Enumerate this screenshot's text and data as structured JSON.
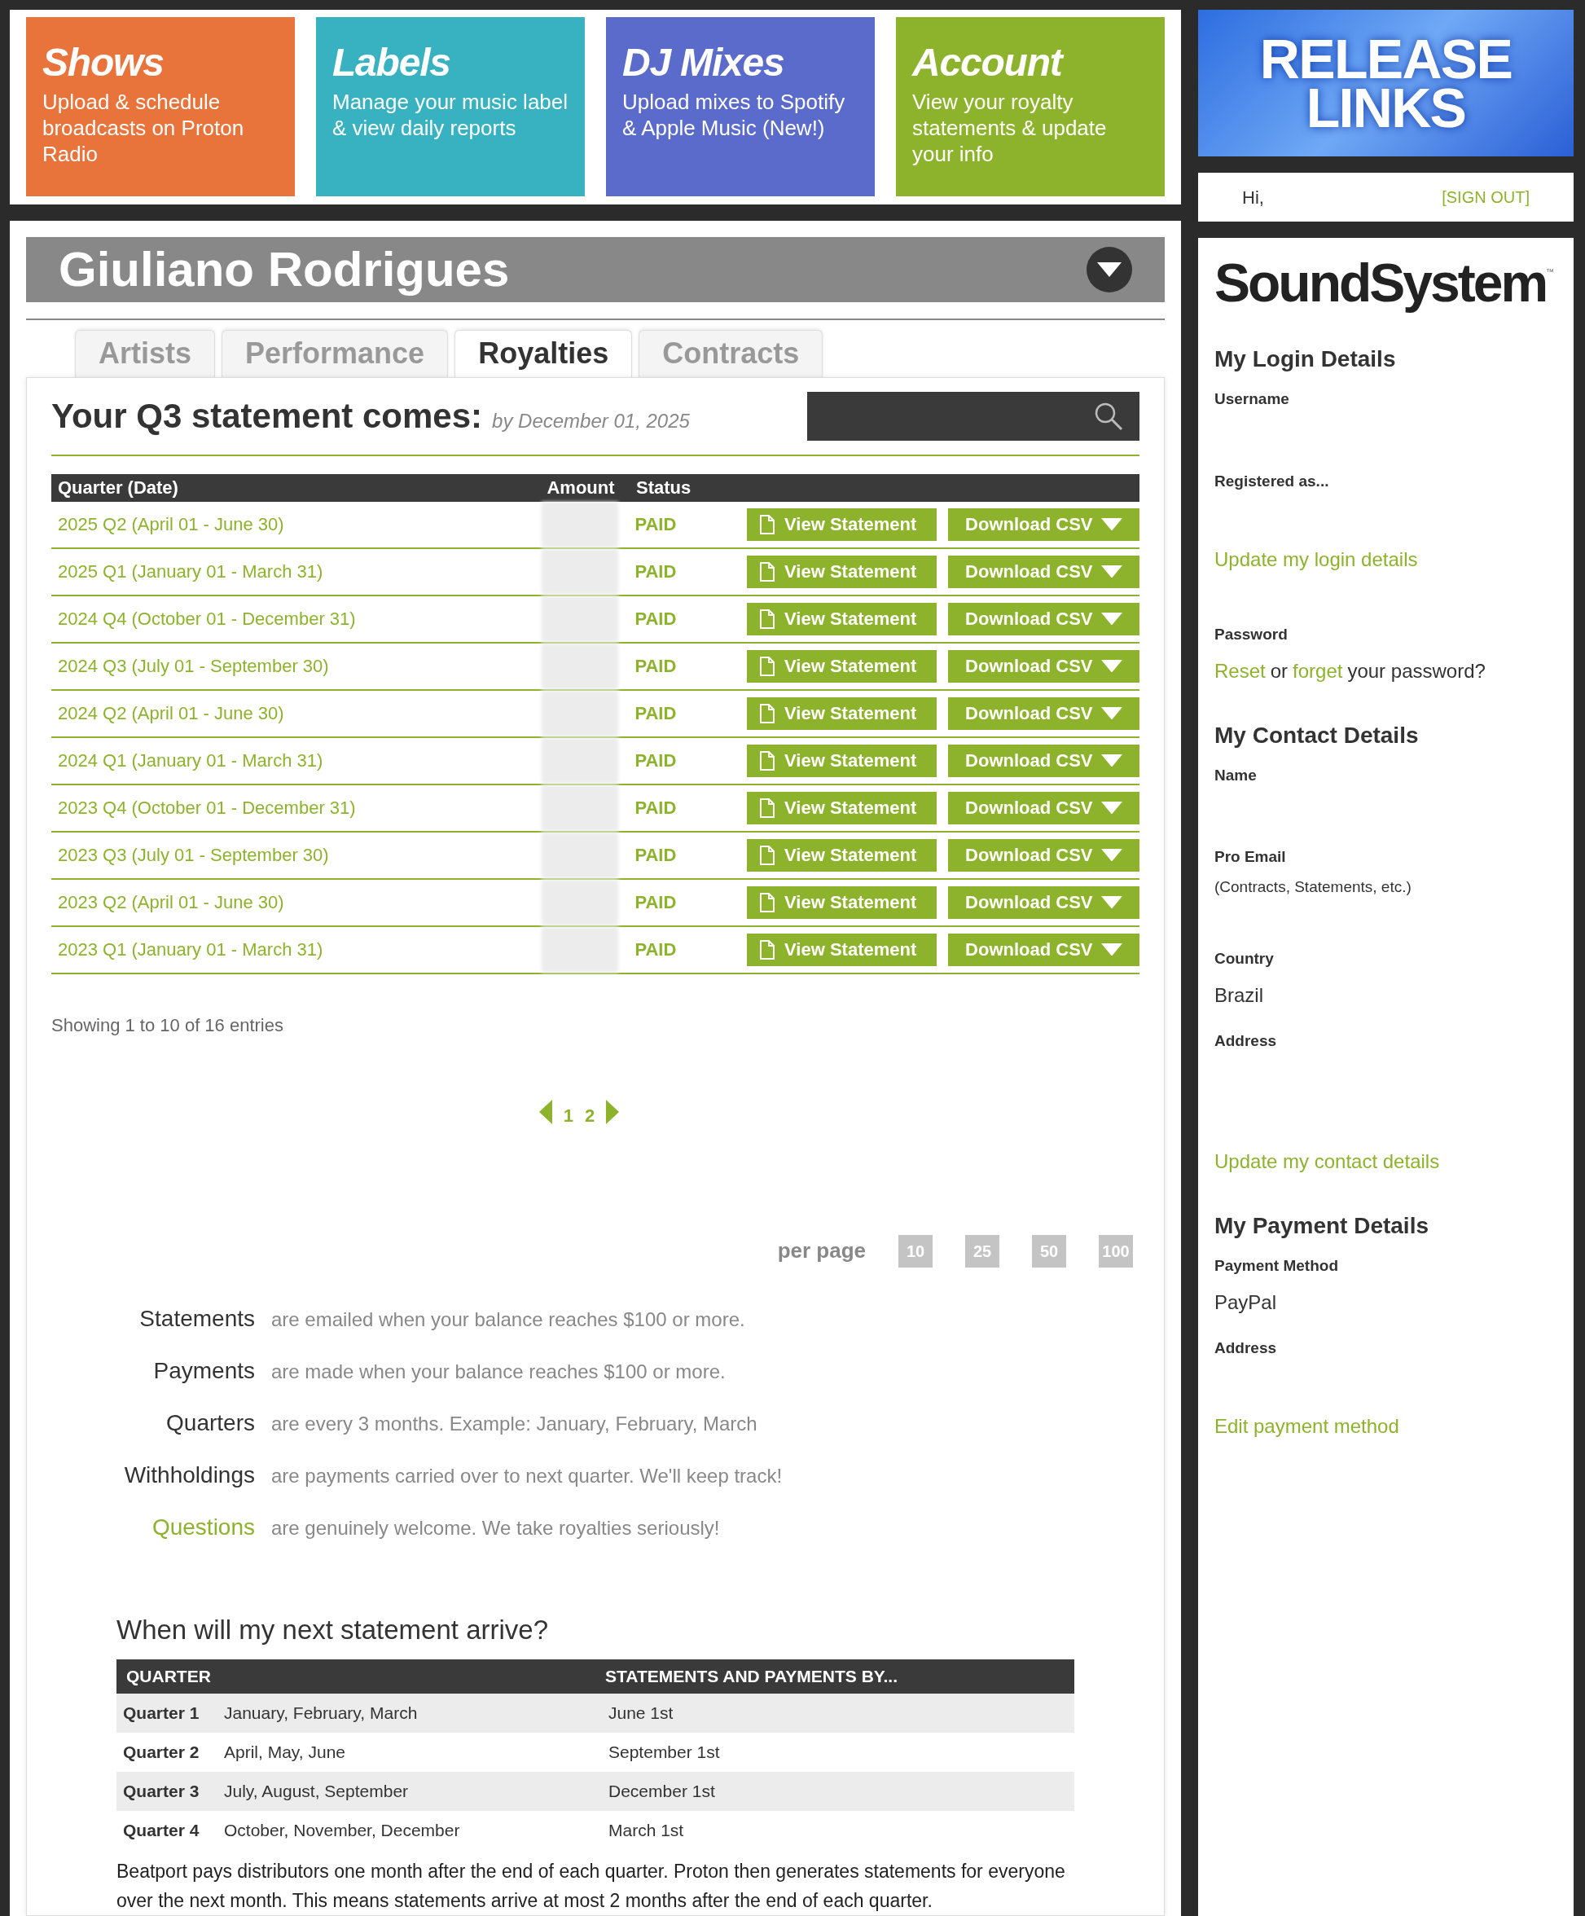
{
  "nav_cards": [
    {
      "title": "Shows",
      "description": "Upload & schedule broadcasts on Proton Radio",
      "color": "#e8743b"
    },
    {
      "title": "Labels",
      "description": "Manage your music label & view daily reports",
      "color": "#38b2c1"
    },
    {
      "title": "DJ Mixes",
      "description": "Upload mixes to Spotify & Apple Music (New!)",
      "color": "#5b6bcb"
    },
    {
      "title": "Account",
      "description": "View your royalty statements & update your info",
      "color": "#8db32d"
    }
  ],
  "promo": {
    "text": "RELEASE LINKS"
  },
  "user_bar": {
    "greeting": "Hi,",
    "sign_out": "[SIGN OUT]"
  },
  "artist": {
    "name": "Giuliano Rodrigues"
  },
  "tabs": [
    {
      "label": "Artists",
      "selected": false
    },
    {
      "label": "Performance",
      "selected": false
    },
    {
      "label": "Royalties",
      "selected": true
    },
    {
      "label": "Contracts",
      "selected": false
    }
  ],
  "statement_notice": {
    "title": "Your Q3 statement comes:",
    "date": "by December 01, 2025"
  },
  "table": {
    "columns": [
      "Quarter (Date)",
      "Amount",
      "Status"
    ],
    "rows": [
      {
        "quarter": "2025 Q2 (April 01 - June 30)",
        "status": "PAID",
        "view": "View Statement",
        "download": "Download CSV"
      },
      {
        "quarter": "2025 Q1 (January 01 - March 31)",
        "status": "PAID",
        "view": "View Statement",
        "download": "Download CSV"
      },
      {
        "quarter": "2024 Q4 (October 01 - December 31)",
        "status": "PAID",
        "view": "View Statement",
        "download": "Download CSV"
      },
      {
        "quarter": "2024 Q3 (July 01 - September 30)",
        "status": "PAID",
        "view": "View Statement",
        "download": "Download CSV"
      },
      {
        "quarter": "2024 Q2 (April 01 - June 30)",
        "status": "PAID",
        "view": "View Statement",
        "download": "Download CSV"
      },
      {
        "quarter": "2024 Q1 (January 01 - March 31)",
        "status": "PAID",
        "view": "View Statement",
        "download": "Download CSV"
      },
      {
        "quarter": "2023 Q4 (October 01 - December 31)",
        "status": "PAID",
        "view": "View Statement",
        "download": "Download CSV"
      },
      {
        "quarter": "2023 Q3 (July 01 - September 30)",
        "status": "PAID",
        "view": "View Statement",
        "download": "Download CSV"
      },
      {
        "quarter": "2023 Q2 (April 01 - June 30)",
        "status": "PAID",
        "view": "View Statement",
        "download": "Download CSV"
      },
      {
        "quarter": "2023 Q1 (January 01 - March 31)",
        "status": "PAID",
        "view": "View Statement",
        "download": "Download CSV"
      }
    ]
  },
  "entries_info": "Showing 1 to 10 of 16 entries",
  "pagination": {
    "pages": [
      "1",
      "2"
    ]
  },
  "per_page": {
    "label": "per page",
    "options": [
      "10",
      "25",
      "50",
      "100"
    ]
  },
  "explanations": [
    {
      "term": "Statements",
      "text": "are emailed when your balance reaches $100 or more.",
      "kind": "plain"
    },
    {
      "term": "Payments",
      "text": "are made when your balance reaches $100 or more.",
      "kind": "plain"
    },
    {
      "term": "Quarters",
      "text": "are every 3 months. Example: January, February, March",
      "kind": "plain"
    },
    {
      "term": "Withholdings",
      "text": "are payments carried over to next quarter. We'll keep track!",
      "kind": "plain"
    },
    {
      "term": "Questions",
      "text": "are genuinely welcome. We take royalties seriously!",
      "kind": "link"
    }
  ],
  "schedule": {
    "heading": "When will my next statement arrive?",
    "columns": [
      "QUARTER",
      "STATEMENTS AND PAYMENTS BY..."
    ],
    "rows": [
      {
        "quarter": "Quarter 1",
        "months": "January, February, March",
        "due": "June 1st"
      },
      {
        "quarter": "Quarter 2",
        "months": "April, May, June",
        "due": "September 1st"
      },
      {
        "quarter": "Quarter 3",
        "months": "July, August, September",
        "due": "December 1st"
      },
      {
        "quarter": "Quarter 4",
        "months": "October, November, December",
        "due": "March 1st"
      }
    ],
    "note": "Beatport pays distributors one month after the end of each quarter. Proton then generates statements for everyone over the next month. This means statements arrive at most 2 months after the end of each quarter."
  },
  "sidebar": {
    "logo": "SoundSystem",
    "logo_mark": "™",
    "sections": [
      {
        "heading": "My Login Details",
        "items": [
          {
            "kind": "label",
            "text": "Username"
          },
          {
            "kind": "gap"
          },
          {
            "kind": "label",
            "text": "Registered as..."
          },
          {
            "kind": "gap"
          },
          {
            "kind": "link",
            "text": "Update my login details"
          },
          {
            "kind": "gap"
          },
          {
            "kind": "label",
            "text": "Password"
          },
          {
            "kind": "password",
            "reset": "Reset",
            "middle": "or",
            "forget": "forget",
            "rest": "your password?"
          }
        ]
      },
      {
        "heading": "My Contact Details",
        "items": [
          {
            "kind": "label",
            "text": "Name"
          },
          {
            "kind": "gap"
          },
          {
            "kind": "label",
            "text": "Pro Email"
          },
          {
            "kind": "note",
            "text": "(Contracts, Statements, etc.)"
          },
          {
            "kind": "gap"
          },
          {
            "kind": "label",
            "text": "Country"
          },
          {
            "kind": "value",
            "text": "Brazil"
          },
          {
            "kind": "label",
            "text": "Address"
          },
          {
            "kind": "gap"
          },
          {
            "kind": "gap"
          },
          {
            "kind": "link",
            "text": "Update my contact details"
          }
        ]
      },
      {
        "heading": "My Payment Details",
        "items": [
          {
            "kind": "label",
            "text": "Payment Method"
          },
          {
            "kind": "value",
            "text": "PayPal"
          },
          {
            "kind": "label",
            "text": "Address"
          },
          {
            "kind": "gap"
          },
          {
            "kind": "link",
            "text": "Edit payment method"
          }
        ]
      }
    ]
  }
}
